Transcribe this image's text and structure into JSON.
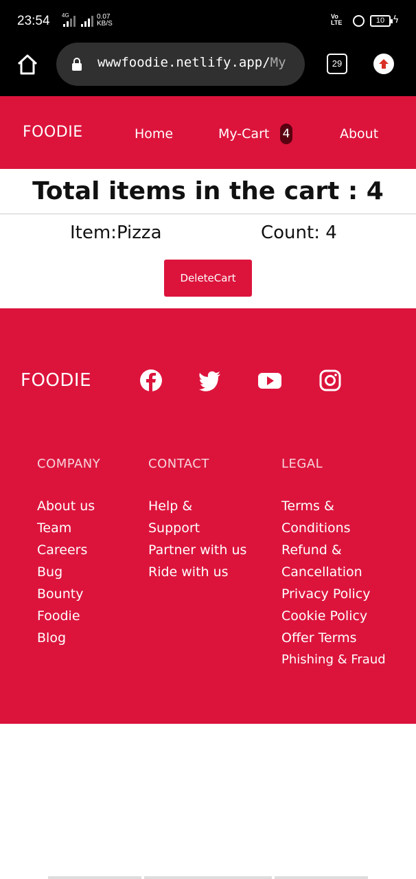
{
  "status": {
    "time": "23:54",
    "net_type": "4G",
    "speed_value": "0.07",
    "speed_unit": "KB/S",
    "volte_top": "Vo",
    "volte_bottom": "LTE",
    "battery": "10"
  },
  "browser": {
    "url_main": "wwwfoodie.netlify.app/",
    "url_rest": "My",
    "tab_count": "29"
  },
  "nav": {
    "brand": "FOODIE",
    "home": "Home",
    "cart": "My-Cart",
    "cart_count": "4",
    "about": "About"
  },
  "cart": {
    "total_label": "Total items in the cart : 4",
    "item_label": "Item:Pizza",
    "count_label": "Count: 4",
    "delete_label": "DeleteCart"
  },
  "footer": {
    "brand": "FOODIE",
    "social_icons": [
      "facebook-icon",
      "twitter-icon",
      "youtube-icon",
      "instagram-icon"
    ],
    "company": {
      "heading": "COMPANY",
      "links": [
        "About us",
        "Team",
        "Careers",
        "Bug Bounty",
        "Foodie Blog"
      ]
    },
    "contact": {
      "heading": "CONTACT",
      "links": [
        "Help & Support",
        "Partner with us",
        "Ride with us"
      ]
    },
    "legal": {
      "heading": "LEGAL",
      "links": [
        "Terms & Conditions",
        "Refund & Cancellation",
        "Privacy Policy",
        "Cookie Policy",
        "Offer Terms",
        "Phishing & Fraud"
      ]
    }
  },
  "colors": {
    "brand_red": "#dc143c",
    "badge_dark": "#5a0010"
  }
}
